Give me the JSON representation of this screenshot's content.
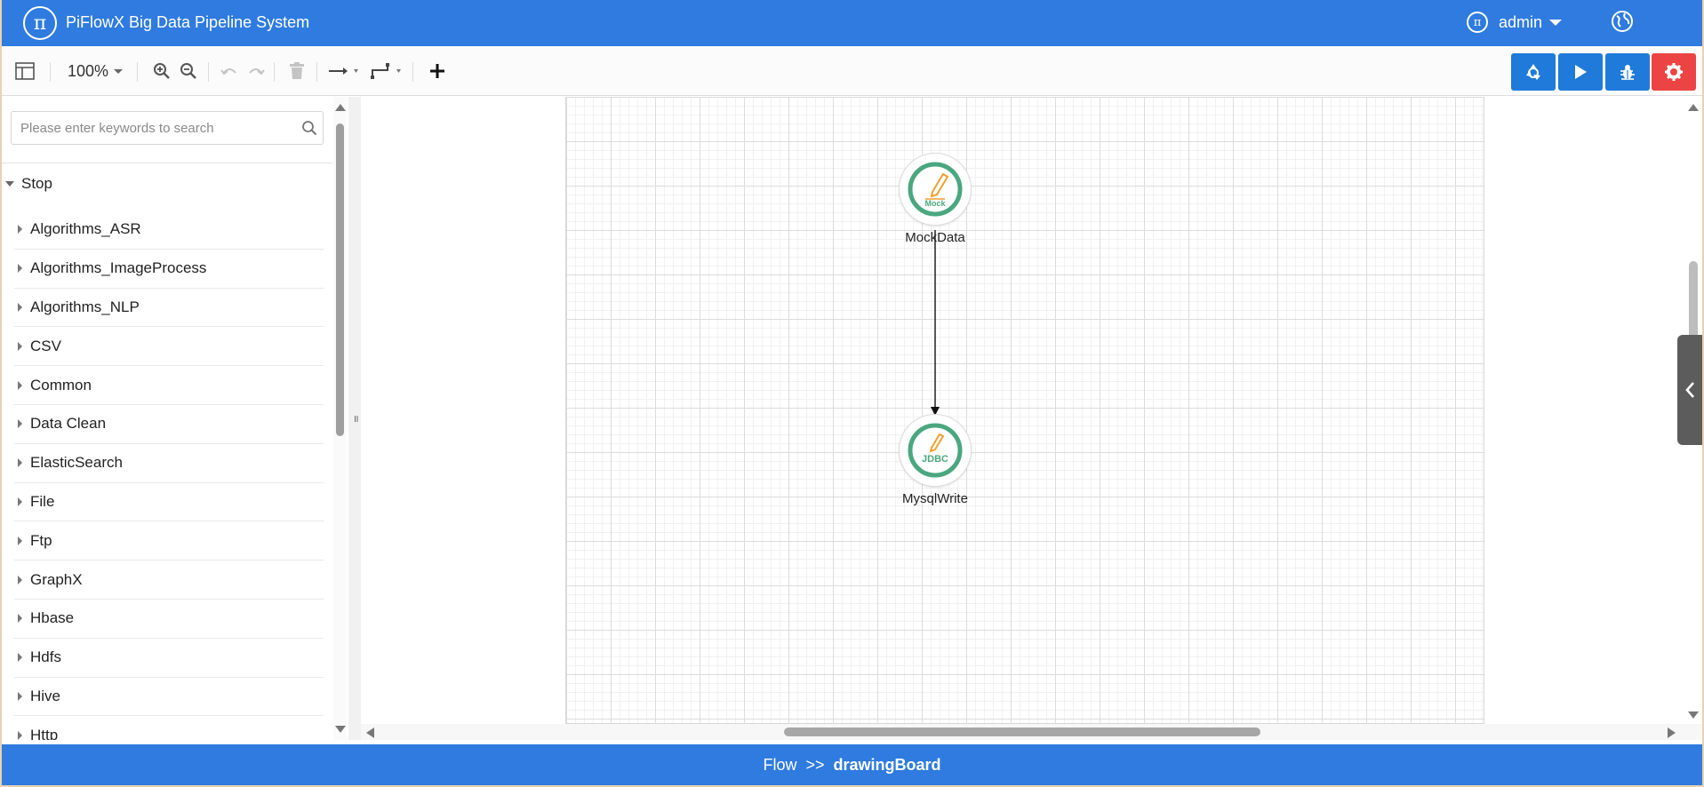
{
  "header": {
    "app_title": "PiFlowX Big Data Pipeline System",
    "logo_glyph": "π",
    "user_name": "admin"
  },
  "toolbar": {
    "zoom": "100%",
    "buttons": [
      "recycle-icon",
      "play-icon",
      "debug-icon",
      "settings-icon"
    ],
    "accent": "#1f7ad9",
    "danger": "#ec4444"
  },
  "sidebar": {
    "search_placeholder": "Please enter keywords to search",
    "group": "Stop",
    "categories": [
      "Algorithms_ASR",
      "Algorithms_ImageProcess",
      "Algorithms_NLP",
      "CSV",
      "Common",
      "Data Clean",
      "ElasticSearch",
      "File",
      "Ftp",
      "GraphX",
      "Hbase",
      "Hdfs",
      "Hive",
      "Http"
    ]
  },
  "canvas": {
    "nodes": [
      {
        "label": "MockData",
        "badge": "Mock"
      },
      {
        "label": "MysqlWrite",
        "badge": "JDBC"
      }
    ]
  },
  "footer": {
    "root": "Flow",
    "separator": ">>",
    "current": "drawingBoard"
  },
  "colors": {
    "header_bg": "#2f7be0",
    "node_ring": "#4aa77f",
    "node_pencil": "#f0a030"
  }
}
